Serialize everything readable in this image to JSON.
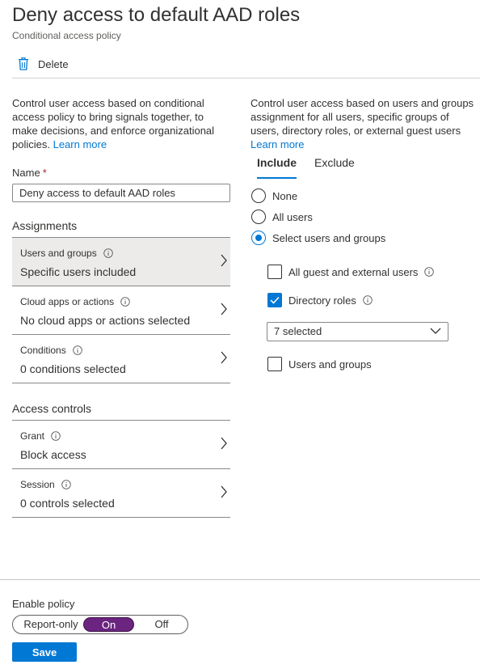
{
  "header": {
    "title": "Deny access to default AAD roles",
    "subtitle": "Conditional access policy"
  },
  "toolbar": {
    "delete_label": "Delete",
    "delete_icon": "trash-icon"
  },
  "left": {
    "description": "Control user access based on conditional access policy to bring signals together, to make decisions, and enforce organizational policies.",
    "learn_more": "Learn more",
    "name_label": "Name",
    "name_required": "*",
    "name_value": "Deny access to default AAD roles",
    "assignments_title": "Assignments",
    "assignments": [
      {
        "label": "Users and groups",
        "value": "Specific users included"
      },
      {
        "label": "Cloud apps or actions",
        "value": "No cloud apps or actions selected"
      },
      {
        "label": "Conditions",
        "value": "0 conditions selected"
      }
    ],
    "access_controls_title": "Access controls",
    "access_controls": [
      {
        "label": "Grant",
        "value": "Block access"
      },
      {
        "label": "Session",
        "value": "0 controls selected"
      }
    ]
  },
  "right": {
    "description": "Control user access based on users and groups assignment for all users, specific groups of users, directory roles, or external guest users",
    "learn_more": "Learn more",
    "tabs": [
      {
        "label": "Include",
        "active": true
      },
      {
        "label": "Exclude",
        "active": false
      }
    ],
    "radios": [
      {
        "label": "None",
        "checked": false
      },
      {
        "label": "All users",
        "checked": false
      },
      {
        "label": "Select users and groups",
        "checked": true
      }
    ],
    "checkboxes": [
      {
        "label": "All guest and external users",
        "checked": false
      },
      {
        "label": "Directory roles",
        "checked": true
      },
      {
        "label": "Users and groups",
        "checked": false
      }
    ],
    "roles_dropdown": "7 selected"
  },
  "footer": {
    "enable_label": "Enable policy",
    "toggle": {
      "options": [
        "Report-only",
        "On",
        "Off"
      ],
      "selected": "On"
    },
    "save_label": "Save"
  },
  "colors": {
    "accent": "#0078d4",
    "toggle_on": "#6b2580",
    "selected_row": "#edebe9"
  }
}
